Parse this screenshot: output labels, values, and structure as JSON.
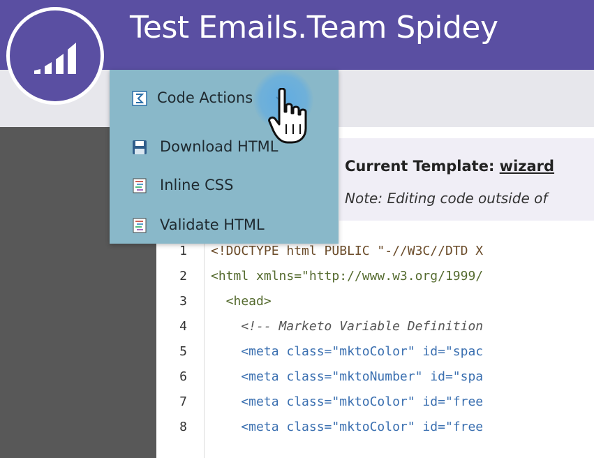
{
  "header": {
    "title": "Test Emails.Team Spidey"
  },
  "menu": {
    "trigger_label": "Code Actions",
    "items": [
      {
        "label": "Download HTML",
        "icon": "floppy-disk-icon"
      },
      {
        "label": "Inline CSS",
        "icon": "code-file-icon"
      },
      {
        "label": "Validate HTML",
        "icon": "code-file-icon"
      }
    ]
  },
  "info": {
    "template_label": "Current Template:",
    "template_name": "wizard",
    "note": "Note: Editing code outside of"
  },
  "editor": {
    "lines": [
      {
        "num": "1",
        "text": "<!DOCTYPE html PUBLIC \"-//W3C//DTD X"
      },
      {
        "num": "2",
        "text": "<html xmlns=\"http://www.w3.org/1999/"
      },
      {
        "num": "3",
        "text": "  <head>"
      },
      {
        "num": "4",
        "text": "    <!-- Marketo Variable Definition"
      },
      {
        "num": "5",
        "text": "    <meta class=\"mktoColor\" id=\"spac"
      },
      {
        "num": "6",
        "text": "    <meta class=\"mktoNumber\" id=\"spa"
      },
      {
        "num": "7",
        "text": "    <meta class=\"mktoColor\" id=\"free"
      },
      {
        "num": "8",
        "text": "    <meta class=\"mktoColor\" id=\"free"
      }
    ]
  },
  "colors": {
    "brand": "#5a4fa2",
    "menu_bg": "#89b8c9",
    "sidebar": "#585858"
  }
}
